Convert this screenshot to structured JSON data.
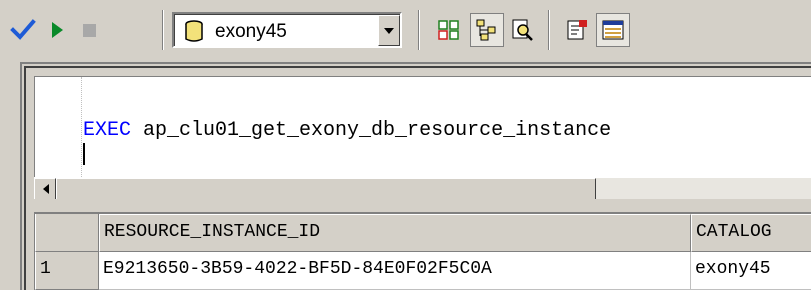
{
  "toolbar": {
    "buttons": [
      {
        "name": "execute-check-icon",
        "color": "#1e5bd6"
      },
      {
        "name": "run-play-icon",
        "color": "#0a8a2a"
      },
      {
        "name": "stop-icon",
        "color": "#a0a0a0"
      }
    ],
    "database": {
      "selected": "exony45",
      "icon": "database-cylinder-icon"
    },
    "tool_icons": [
      "results-grid-icon",
      "object-browser-icon",
      "find-icon",
      "options-icon",
      "results-pane-icon"
    ]
  },
  "editor": {
    "sql_keyword": "EXEC",
    "sql_rest": " ap_clu01_get_exony_db_resource_instance",
    "keyword_color": "#0000ff"
  },
  "results": {
    "columns": [
      "RESOURCE_INSTANCE_ID",
      "CATALOG"
    ],
    "rows": [
      {
        "num": "1",
        "cells": [
          "E9213650-3B59-4022-BF5D-84E0F02F5C0A",
          "exony45"
        ]
      }
    ]
  }
}
